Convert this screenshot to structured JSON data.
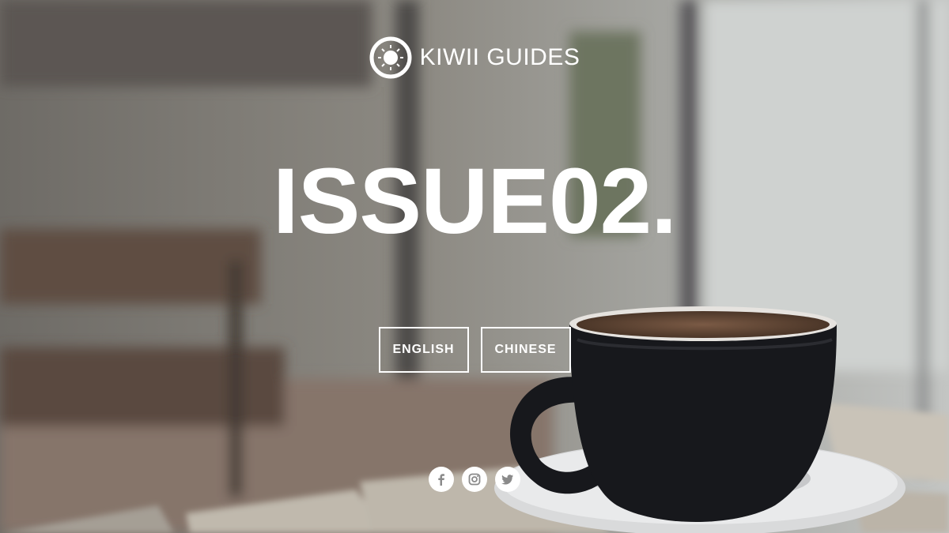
{
  "brand": {
    "name": "KIWII GUIDES",
    "logo_icon": "sun-ring-icon"
  },
  "hero": {
    "title": "ISSUE02."
  },
  "language_buttons": [
    {
      "label": "ENGLISH"
    },
    {
      "label": "CHINESE"
    }
  ],
  "social": [
    {
      "icon": "facebook-icon"
    },
    {
      "icon": "instagram-icon"
    },
    {
      "icon": "twitter-icon"
    }
  ],
  "colors": {
    "text": "#ffffff",
    "cup": "#17181c",
    "table": "#b9b3a8",
    "bench": "#5d4d42"
  }
}
